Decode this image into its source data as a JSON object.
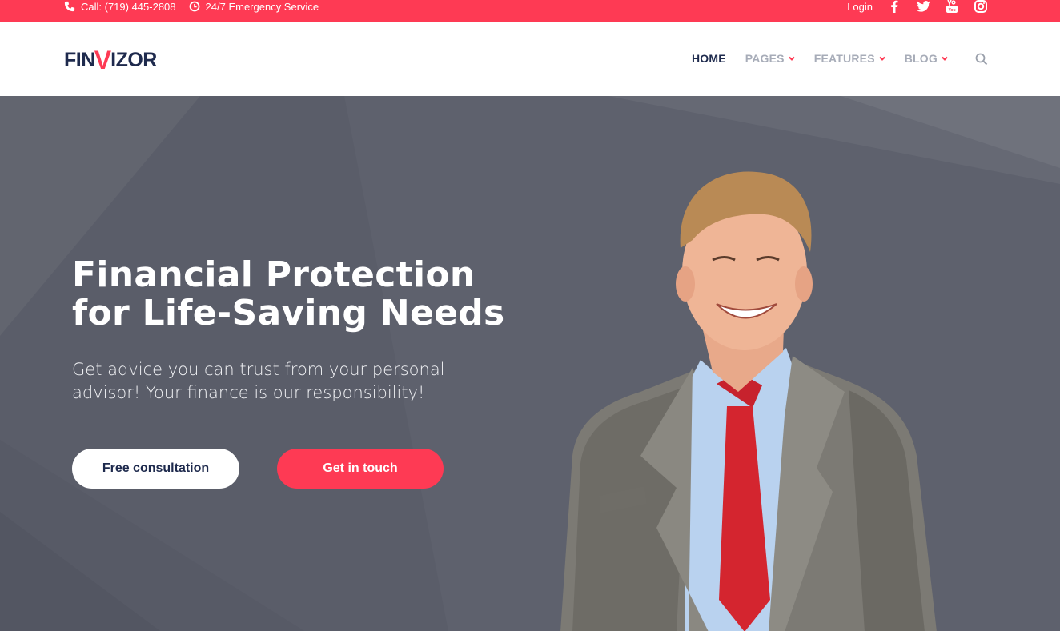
{
  "topbar": {
    "phone": "Call: (719) 445-2808",
    "service": "24/7 Emergency Service",
    "login": "Login",
    "social": [
      "facebook-icon",
      "twitter-icon",
      "youtube-icon",
      "instagram-icon"
    ]
  },
  "header": {
    "logo_prefix": "FIN",
    "logo_v": "V",
    "logo_suffix": "IZOR",
    "nav": [
      {
        "label": "HOME",
        "active": true
      },
      {
        "label": "PAGES",
        "dropdown": true
      },
      {
        "label": "FEATURES",
        "dropdown": true
      },
      {
        "label": "BLOG",
        "dropdown": true
      }
    ]
  },
  "hero": {
    "title_line1": "Financial Protection",
    "title_line2": "for Life-Saving Needs",
    "subtitle": "Get advice you can trust from your personal advisor! Your finance is our responsibility!",
    "btn_primary": "Free consultation",
    "btn_secondary": "Get in touch"
  },
  "colors": {
    "accent": "#fe3a54",
    "navy": "#1e2a4d",
    "hero_bg": "#5e616d"
  }
}
